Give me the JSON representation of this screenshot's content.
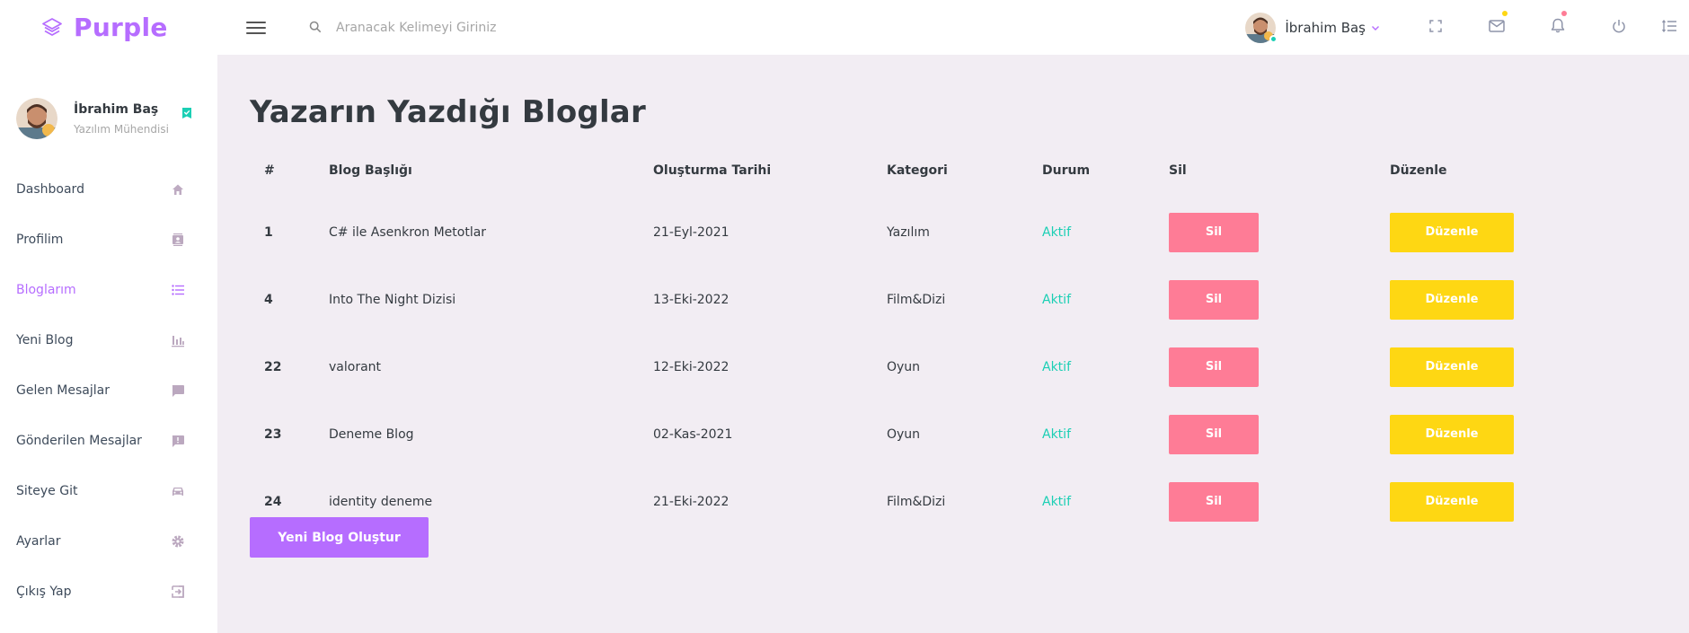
{
  "brand": {
    "name": "Purple"
  },
  "search": {
    "placeholder": "Aranacak Kelimeyi Giriniz"
  },
  "user": {
    "name": "İbrahim Baş",
    "role": "Yazılım Mühendisi"
  },
  "navbar": {
    "icons": [
      "fullscreen-icon",
      "mail-icon",
      "bell-icon",
      "power-icon",
      "format-list-icon"
    ],
    "badge_colors": {
      "mail": "#fed713",
      "bell": "#fe7c96"
    }
  },
  "sidebar": {
    "items": [
      {
        "label": "Dashboard",
        "icon": "home-icon",
        "active": false
      },
      {
        "label": "Profilim",
        "icon": "contacts-icon",
        "active": false
      },
      {
        "label": "Bloglarım",
        "icon": "format-list-bulleted-icon",
        "active": true
      },
      {
        "label": "Yeni Blog",
        "icon": "chart-bar-icon",
        "active": false
      },
      {
        "label": "Gelen Mesajlar",
        "icon": "message-icon",
        "active": false
      },
      {
        "label": "Gönderilen Mesajlar",
        "icon": "message-alert-icon",
        "active": false
      },
      {
        "label": "Siteye Git",
        "icon": "car-icon",
        "active": false
      },
      {
        "label": "Ayarlar",
        "icon": "settings-icon",
        "active": false
      },
      {
        "label": "Çıkış Yap",
        "icon": "logout-icon",
        "active": false
      }
    ]
  },
  "main": {
    "title": "Yazarın Yazdığı Bloglar",
    "table": {
      "headers": [
        "#",
        "Blog Başlığı",
        "Oluşturma Tarihi",
        "Kategori",
        "Durum",
        "Sil",
        "Düzenle"
      ],
      "rows": [
        {
          "id": "1",
          "title": "C# ile Asenkron Metotlar",
          "date": "21-Eyl-2021",
          "category": "Yazılım",
          "status": "Aktif",
          "delete_label": "Sil",
          "edit_label": "Düzenle"
        },
        {
          "id": "4",
          "title": "Into The Night Dizisi",
          "date": "13-Eki-2022",
          "category": "Film&Dizi",
          "status": "Aktif",
          "delete_label": "Sil",
          "edit_label": "Düzenle"
        },
        {
          "id": "22",
          "title": "valorant",
          "date": "12-Eki-2022",
          "category": "Oyun",
          "status": "Aktif",
          "delete_label": "Sil",
          "edit_label": "Düzenle"
        },
        {
          "id": "23",
          "title": "Deneme Blog",
          "date": "02-Kas-2021",
          "category": "Oyun",
          "status": "Aktif",
          "delete_label": "Sil",
          "edit_label": "Düzenle"
        },
        {
          "id": "24",
          "title": "identity deneme",
          "date": "21-Eki-2022",
          "category": "Film&Dizi",
          "status": "Aktif",
          "delete_label": "Sil",
          "edit_label": "Düzenle"
        }
      ]
    },
    "new_button": "Yeni Blog Oluştur"
  },
  "colors": {
    "accent": "#b66dff",
    "success": "#1bcfb4",
    "danger": "#fe7c96",
    "warning": "#fed713",
    "background": "#f2edf3"
  }
}
